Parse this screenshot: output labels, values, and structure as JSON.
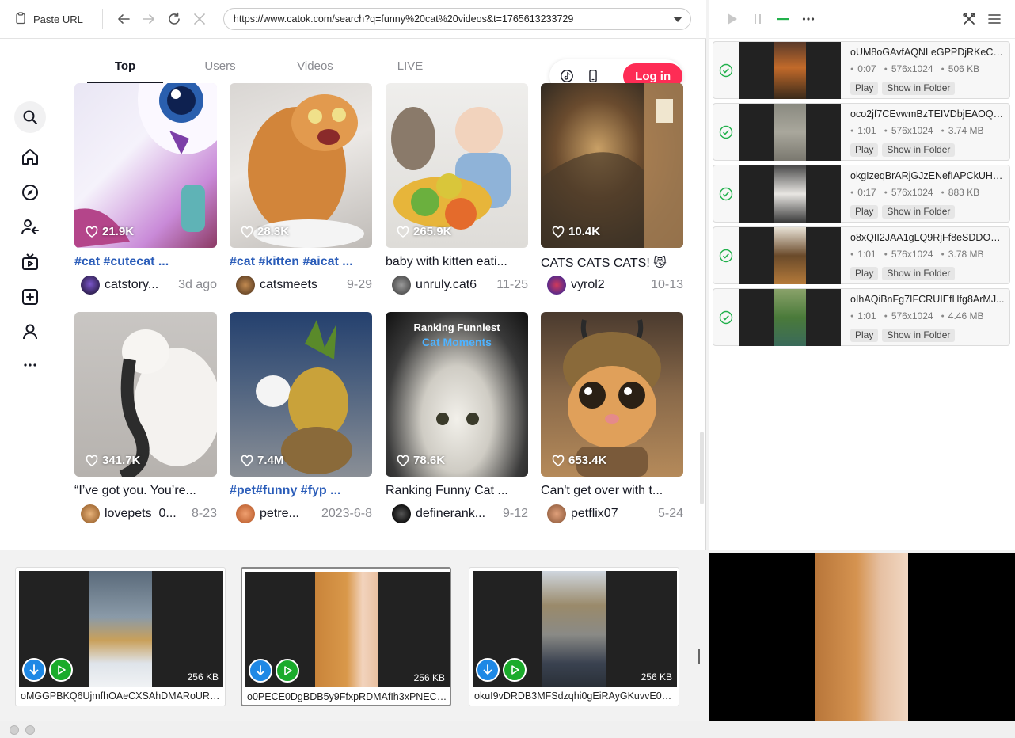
{
  "toolbar": {
    "paste_label": "Paste URL",
    "url": "https://www.catok.com/search?q=funny%20cat%20videos&t=1765613233729"
  },
  "tabs": [
    "Top",
    "Users",
    "Videos",
    "LIVE"
  ],
  "login_label": "Log in",
  "videos": [
    {
      "likes": "21.9K",
      "caption": "#cat #cutecat ...",
      "tag": true,
      "author": "catstory...",
      "date": "3d ago"
    },
    {
      "likes": "28.3K",
      "caption": "#cat #kitten #aicat ...",
      "tag": true,
      "author": "catsmeets",
      "date": "9-29"
    },
    {
      "likes": "265.9K",
      "caption": "baby with kitten eati...",
      "tag": false,
      "author": "unruly.cat6",
      "date": "11-25"
    },
    {
      "likes": "10.4K",
      "caption": "CATS CATS CATS! 😼",
      "tag": false,
      "author": "vyrol2",
      "date": "10-13"
    },
    {
      "likes": "341.7K",
      "caption": "“I’ve got you. You’re...",
      "tag": false,
      "author": "lovepets_0...",
      "date": "8-23"
    },
    {
      "likes": "7.4M",
      "caption": "#pet#funny #fyp ...",
      "tag": true,
      "author": "petre...",
      "date": "2023-6-8"
    },
    {
      "likes": "78.6K",
      "caption": "Ranking Funny Cat ...",
      "tag": false,
      "author": "definerank...",
      "date": "9-12"
    },
    {
      "likes": "653.4K",
      "caption": "Can't get over with t...",
      "tag": false,
      "author": "petflix07",
      "date": "5-24"
    }
  ],
  "thumb_overlay": {
    "line1": "Ranking Funniest",
    "line2": "Cat Moments"
  },
  "downloads": [
    {
      "name": "oUM8oGAvfAQNLeGPPDjRKeCO...",
      "duration": "0:07",
      "resolution": "576x1024",
      "size": "506 KB"
    },
    {
      "name": "oco2jf7CEvwmBzTEIVDbjEAOQR...",
      "duration": "1:01",
      "resolution": "576x1024",
      "size": "3.74 MB"
    },
    {
      "name": "okgIzeqBrARjGJzENefIAPCkUHg...",
      "duration": "0:17",
      "resolution": "576x1024",
      "size": "883 KB"
    },
    {
      "name": "o8xQII2JAA1gLQ9RjFf8eSDDOH...",
      "duration": "1:01",
      "resolution": "576x1024",
      "size": "3.78 MB"
    },
    {
      "name": "oIhAQiBnFg7IFCRUIEfHfg8ArMJ...",
      "duration": "1:01",
      "resolution": "576x1024",
      "size": "4.46 MB"
    }
  ],
  "download_buttons": {
    "play": "Play",
    "folder": "Show in Folder"
  },
  "detected": [
    {
      "name": "oMGGPBKQ6UjmfhOAeCXSAhDMARoURD...",
      "size": "256 KB"
    },
    {
      "name": "o0PECE0DgBDB5y9FfxpRDMAfIh3xPNECza...",
      "size": "256 KB"
    },
    {
      "name": "okuI9vDRDB3MFSdzqhi0gEiRAyGKuvvE0B...",
      "size": "256 KB"
    }
  ],
  "colors": {
    "accent_red": "#fe2c55",
    "success_green": "#22b14c",
    "download_blue": "#1e88e5",
    "play_green": "#1aab2b"
  }
}
